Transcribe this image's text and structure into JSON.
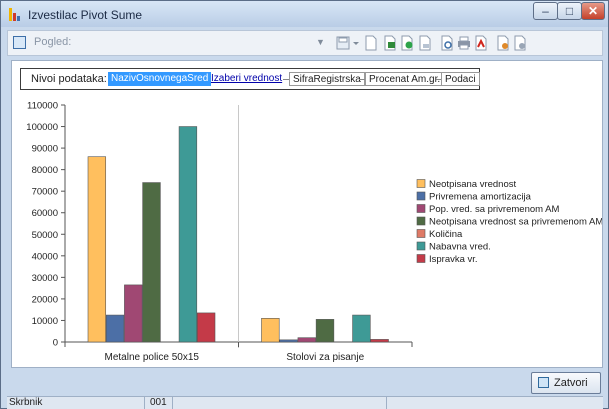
{
  "window": {
    "title": "Izvestilac Pivot Sume"
  },
  "toolbar": {
    "view_label": "Pogled:"
  },
  "levels": {
    "label": "Nivoi podataka:",
    "items": [
      "NazivOsnovnegaSred",
      "Izaberi vrednost",
      "SifraRegistrska",
      "Procenat Am.gr.",
      "Podaci"
    ]
  },
  "buttons": {
    "close_label": "Zatvori"
  },
  "status": {
    "user": "Skrbnik",
    "code": "001"
  },
  "colors": {
    "series": [
      "#ffbf5e",
      "#4c6fa6",
      "#a04873",
      "#4f6b44",
      "#df7a66",
      "#3e9a96",
      "#c43a48"
    ]
  },
  "chart_data": {
    "type": "bar",
    "categories": [
      "Metalne police 50x15",
      "Stolovi za pisanje"
    ],
    "ylim": [
      0,
      110000
    ],
    "yticks": [
      0,
      10000,
      20000,
      30000,
      40000,
      50000,
      60000,
      70000,
      80000,
      90000,
      100000,
      110000
    ],
    "series": [
      {
        "name": "Neotpisana vrednost",
        "values": [
          86000,
          11000
        ]
      },
      {
        "name": "Privremena amortizacija",
        "values": [
          12500,
          1000
        ]
      },
      {
        "name": "Pop. vred. sa privremenom AM",
        "values": [
          26500,
          2000
        ]
      },
      {
        "name": "Neotpisana vrednost sa privremenom AM",
        "values": [
          74000,
          10500
        ]
      },
      {
        "name": "Količina",
        "values": [
          0,
          0
        ]
      },
      {
        "name": "Nabavna vred.",
        "values": [
          100000,
          12500
        ]
      },
      {
        "name": "Ispravka vr.",
        "values": [
          13500,
          1200
        ]
      }
    ],
    "legend": "right",
    "grid": false
  }
}
